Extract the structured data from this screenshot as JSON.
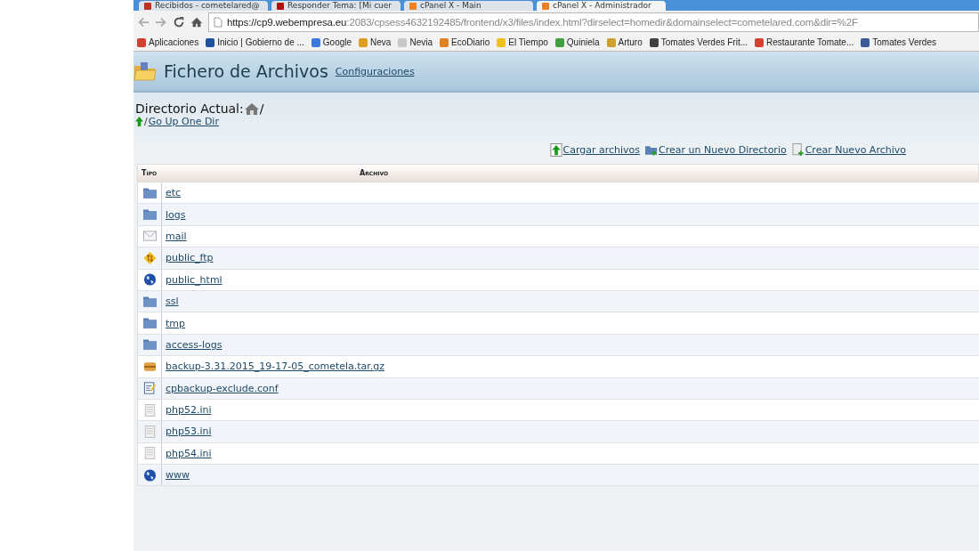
{
  "browser": {
    "tabs": [
      {
        "title": "Recibidos - cometelared@",
        "selected": false
      },
      {
        "title": "Responder Tema: [Mi cuer",
        "selected": false
      },
      {
        "title": "cPanel X - Main",
        "selected": false
      },
      {
        "title": "cPanel X - Administrador",
        "selected": true
      }
    ],
    "url_host": "https://cp9.webempresa.eu",
    "url_rest": ":2083/cpsess4632192485/frontend/x3/files/index.html?dirselect=homedir&domainselect=cometelared.com&dir=%2F",
    "bookmarks": [
      {
        "label": "Aplicaciones",
        "color": "#d04030"
      },
      {
        "label": "Inicio | Gobierno de ...",
        "color": "#2050a0"
      },
      {
        "label": "Google",
        "color": "#3a78e0"
      },
      {
        "label": "Neva",
        "color": "#e0a020"
      },
      {
        "label": "Nevia",
        "color": "#c8c8c8"
      },
      {
        "label": "EcoDiario",
        "color": "#e08020"
      },
      {
        "label": "El Tiempo",
        "color": "#f0c020"
      },
      {
        "label": "Quiniela",
        "color": "#40a040"
      },
      {
        "label": "Arturo",
        "color": "#d0a030"
      },
      {
        "label": "Tomates Verdes Frit...",
        "color": "#404040"
      },
      {
        "label": "Restaurante Tomate...",
        "color": "#d84030"
      },
      {
        "label": "Tomates Verdes",
        "color": "#3b5998"
      }
    ]
  },
  "header": {
    "title": "Fichero de Archivos",
    "settings_link": "Configuraciones"
  },
  "current_dir": {
    "label": "Directorio Actual:",
    "path": "/",
    "up_sep": "/",
    "up_link": "Go Up One Dir"
  },
  "actions": [
    {
      "label": "Cargar archivos",
      "kind": "upload"
    },
    {
      "label": "Crear un Nuevo Directorio",
      "kind": "newdir"
    },
    {
      "label": "Crear Nuevo Archivo",
      "kind": "newfile"
    }
  ],
  "table": {
    "columns": [
      "Tipo",
      "Archivo"
    ],
    "rows": [
      {
        "name": "etc",
        "kind": "folder"
      },
      {
        "name": "logs",
        "kind": "folder"
      },
      {
        "name": "mail",
        "kind": "mail"
      },
      {
        "name": "public_ftp",
        "kind": "ftp"
      },
      {
        "name": "public_html",
        "kind": "globe"
      },
      {
        "name": "ssl",
        "kind": "folder"
      },
      {
        "name": "tmp",
        "kind": "folder"
      },
      {
        "name": "access-logs",
        "kind": "folder"
      },
      {
        "name": "backup-3.31.2015_19-17-05_cometela.tar.gz",
        "kind": "archive"
      },
      {
        "name": "cpbackup-exclude.conf",
        "kind": "conf"
      },
      {
        "name": "php52.ini",
        "kind": "file"
      },
      {
        "name": "php53.ini",
        "kind": "file"
      },
      {
        "name": "php54.ini",
        "kind": "file"
      },
      {
        "name": "www",
        "kind": "globe"
      }
    ]
  }
}
